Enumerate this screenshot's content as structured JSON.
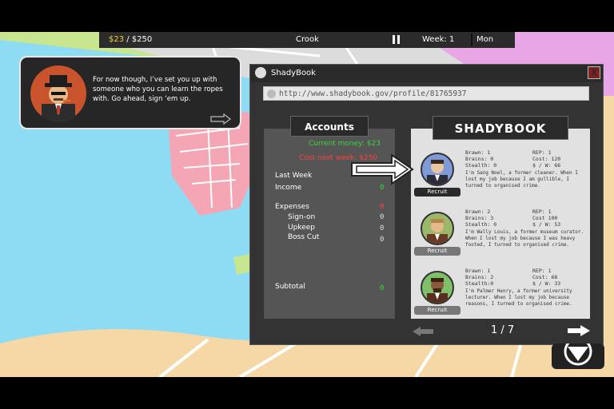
{
  "topbar": {
    "money_current": "$23",
    "money_sep": " / ",
    "money_target": "$250",
    "rank": "Crook",
    "week_label": "Week:",
    "week_value": "1",
    "day": "Mon"
  },
  "dialog": {
    "text": "For now though, I’ve set you up with someone who you can learn the ropes with. Go ahead, sign ‘em up."
  },
  "window": {
    "title": "ShadyBook",
    "close": "X",
    "url": "http://www.shadybook.gov/profile/81765937"
  },
  "accounts": {
    "title": "Accounts",
    "current_money": "Current money: $23",
    "cost_next_week": "Cost next week: $250",
    "last_week": "Last Week",
    "income": "Income",
    "income_value": "0",
    "expenses": "Expenses",
    "expenses_value": "0",
    "sign_on": "Sign-on",
    "sign_on_value": "0",
    "upkeep": "Upkeep",
    "upkeep_value": "0",
    "boss_cut": "Boss Cut",
    "boss_cut_value": "0",
    "subtotal": "Subtotal",
    "subtotal_value": "0"
  },
  "shadybook": {
    "title": "SHADYBOOK",
    "recruit_label": "Recruit",
    "profiles": [
      {
        "brawn": "Brawn:    1",
        "brains": "Brains:   0",
        "stealth": "Stealth:  0",
        "rep": "REP:    1",
        "cost": "Cost:   120",
        "sw": "$ / W:  66",
        "bio": "I'm Sang Noel, a former cleaner. When I lost my job because I am gullible, I turned to organised crime.",
        "skin": "#e8c6a0",
        "hair": "#3a2a1e",
        "bg": "#7f9ad8",
        "recruit_color": "#2a2a2a"
      },
      {
        "brawn": "Brawn:    2",
        "brains": "Brains:   3",
        "stealth": "Stealth:  0",
        "rep": "REP:    1",
        "cost": "Cost    100",
        "sw": "$ / W:  53",
        "bio": "I'm Wally Louis, a former museum curator. When I lost my job because I was heavy footed, I turned to organised crime.",
        "skin": "#e6b98c",
        "hair": "#b4874d",
        "bg": "#9bb86a",
        "recruit_color": "#777777"
      },
      {
        "brawn": "Brawn:    1",
        "brains": "Brains: 2",
        "stealth": "Stealth:0",
        "rep": "REP:    1",
        "cost": "Cost:   68",
        "sw": "$ / W:  33",
        "bio": "I'm Palmer Henry, a former university lecturer. When I lost my job because reasons, I turned to organised crime.",
        "skin": "#8a5a3a",
        "hair": "#3a2416",
        "bg": "#7fbf6a",
        "recruit_color": "#777777"
      }
    ]
  },
  "pager": {
    "page": "1 / 7"
  },
  "colors": {
    "accent_yellow": "#f2d23a",
    "money_green": "#3bd63b",
    "cost_red": "#ff4040",
    "close_red": "#7a2424"
  },
  "icons": [
    "pause-icon",
    "globe-icon",
    "shady-logo-icon",
    "close-icon",
    "arrow-left-icon",
    "arrow-right-icon",
    "tutorial-arrow-icon"
  ]
}
